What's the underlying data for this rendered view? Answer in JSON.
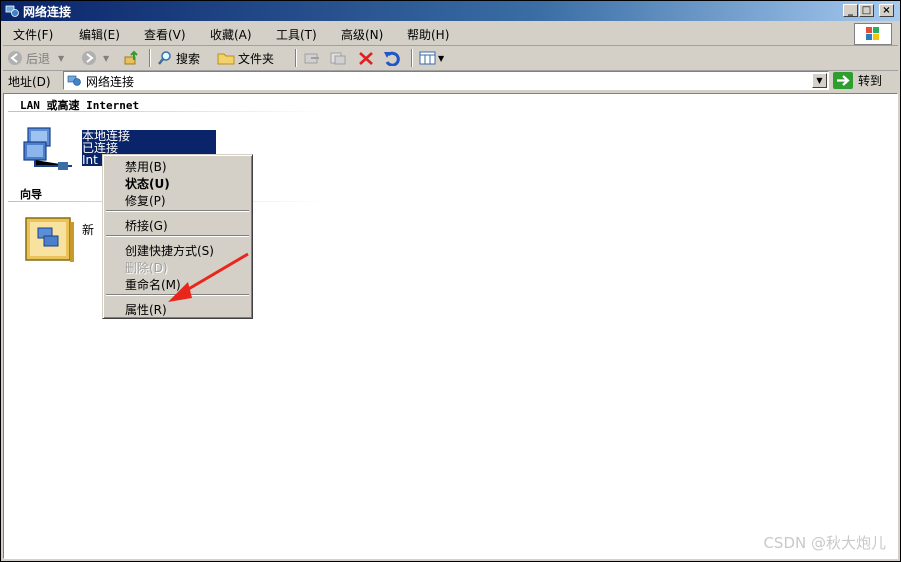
{
  "window": {
    "title": "网络连接",
    "minimize": "_",
    "maximize": "□",
    "close": "×"
  },
  "menubar": {
    "items": [
      "文件(F)",
      "编辑(E)",
      "查看(V)",
      "收藏(A)",
      "工具(T)",
      "高级(N)",
      "帮助(H)"
    ]
  },
  "toolbar": {
    "back_label": "后退",
    "search_label": "搜索",
    "folders_label": "文件夹"
  },
  "address": {
    "label": "地址(D)",
    "value": "网络连接",
    "go_label": "转到"
  },
  "content": {
    "group_lan": "LAN 或高速 Internet",
    "group_wizard": "向导",
    "connection": {
      "name": "本地连接",
      "status": "已连接",
      "device_prefix": "Int"
    },
    "wizard_item_partial": "新"
  },
  "context_menu": {
    "items": [
      {
        "label": "禁用(B)",
        "state": "normal"
      },
      {
        "label": "状态(U)",
        "state": "bold"
      },
      {
        "label": "修复(P)",
        "state": "normal"
      },
      {
        "label": "桥接(G)",
        "state": "normal"
      },
      {
        "label": "创建快捷方式(S)",
        "state": "normal"
      },
      {
        "label": "删除(D)",
        "state": "disabled"
      },
      {
        "label": "重命名(M)",
        "state": "normal"
      },
      {
        "label": "属性(R)",
        "state": "normal"
      }
    ]
  },
  "annotation": {
    "arrow_color": "#e8261c"
  },
  "watermark": "CSDN @秋大炮儿",
  "colors": {
    "titlebar_start": "#0a246a",
    "titlebar_end": "#a6caf0",
    "selection": "#0a246a",
    "chrome": "#d4d0c8"
  }
}
